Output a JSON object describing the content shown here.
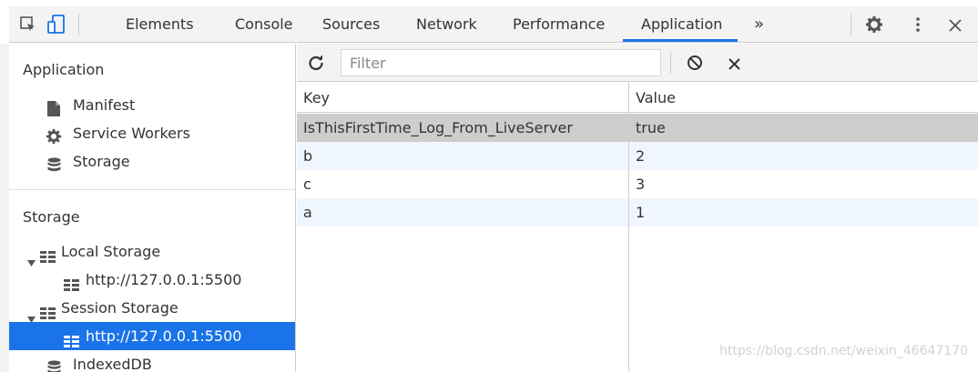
{
  "toolbar_tabs": {
    "elements": "Elements",
    "console": "Console",
    "sources": "Sources",
    "network": "Network",
    "performance": "Performance",
    "application": "Application",
    "more": "»"
  },
  "sidebar": {
    "application_header": "Application",
    "manifest": "Manifest",
    "service_workers": "Service Workers",
    "storage_item": "Storage",
    "storage_header": "Storage",
    "local_storage": "Local Storage",
    "local_storage_origin": "http://127.0.0.1:5500",
    "session_storage": "Session Storage",
    "session_storage_origin": "http://127.0.0.1:5500",
    "indexeddb": "IndexedDB"
  },
  "filter": {
    "placeholder": "Filter"
  },
  "table": {
    "headers": {
      "key": "Key",
      "value": "Value"
    },
    "rows": [
      {
        "key": "IsThisFirstTime_Log_From_LiveServer",
        "value": "true"
      },
      {
        "key": "b",
        "value": "2"
      },
      {
        "key": "c",
        "value": "3"
      },
      {
        "key": "a",
        "value": "1"
      }
    ]
  },
  "watermark": "https://blog.csdn.net/weixin_46647170",
  "colors": {
    "accent": "#1a73e8",
    "selected_row": "#cdcdcd",
    "alt_row": "#f0f6fd",
    "panel_bg": "#f3f3f3"
  }
}
